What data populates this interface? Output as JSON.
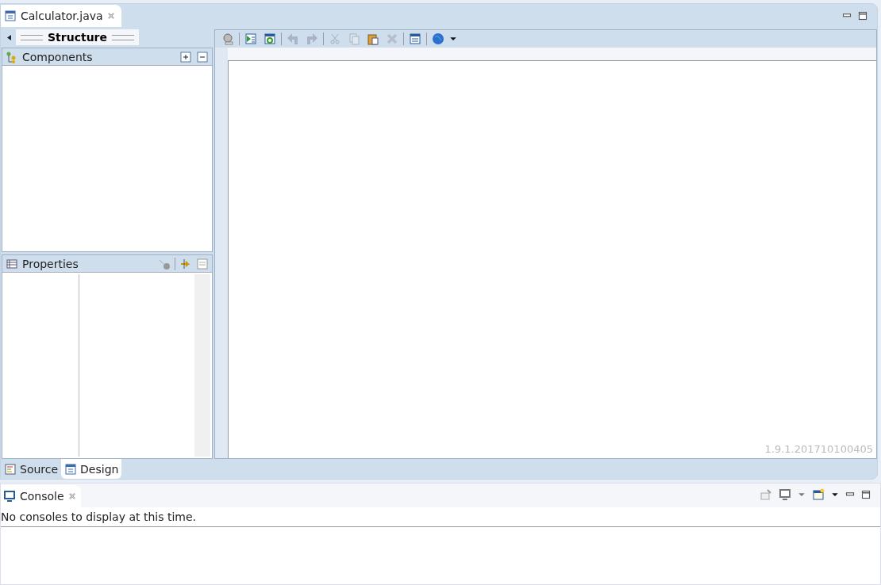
{
  "editor_tab": {
    "label": "Calculator.java",
    "selected": true
  },
  "structure": {
    "title": "Structure"
  },
  "components": {
    "title": "Components"
  },
  "properties": {
    "title": "Properties"
  },
  "toolbar": [
    {
      "kind": "test",
      "disabled": false
    },
    {
      "kind": "sep"
    },
    {
      "kind": "run",
      "disabled": false
    },
    {
      "kind": "refresh",
      "disabled": false
    },
    {
      "kind": "sep"
    },
    {
      "kind": "undo",
      "disabled": true
    },
    {
      "kind": "redo",
      "disabled": true
    },
    {
      "kind": "sep"
    },
    {
      "kind": "cut",
      "disabled": true
    },
    {
      "kind": "copy",
      "disabled": true
    },
    {
      "kind": "paste",
      "disabled": false
    },
    {
      "kind": "delete",
      "disabled": true
    },
    {
      "kind": "sep"
    },
    {
      "kind": "layout",
      "disabled": false
    },
    {
      "kind": "sep"
    },
    {
      "kind": "globe",
      "disabled": false
    }
  ],
  "version": "1.9.1.201710100405",
  "bottom_tabs": [
    {
      "label": "Source",
      "selected": false
    },
    {
      "label": "Design",
      "selected": true
    }
  ],
  "console": {
    "tab": "Console",
    "message": "No consoles to display at this time."
  }
}
